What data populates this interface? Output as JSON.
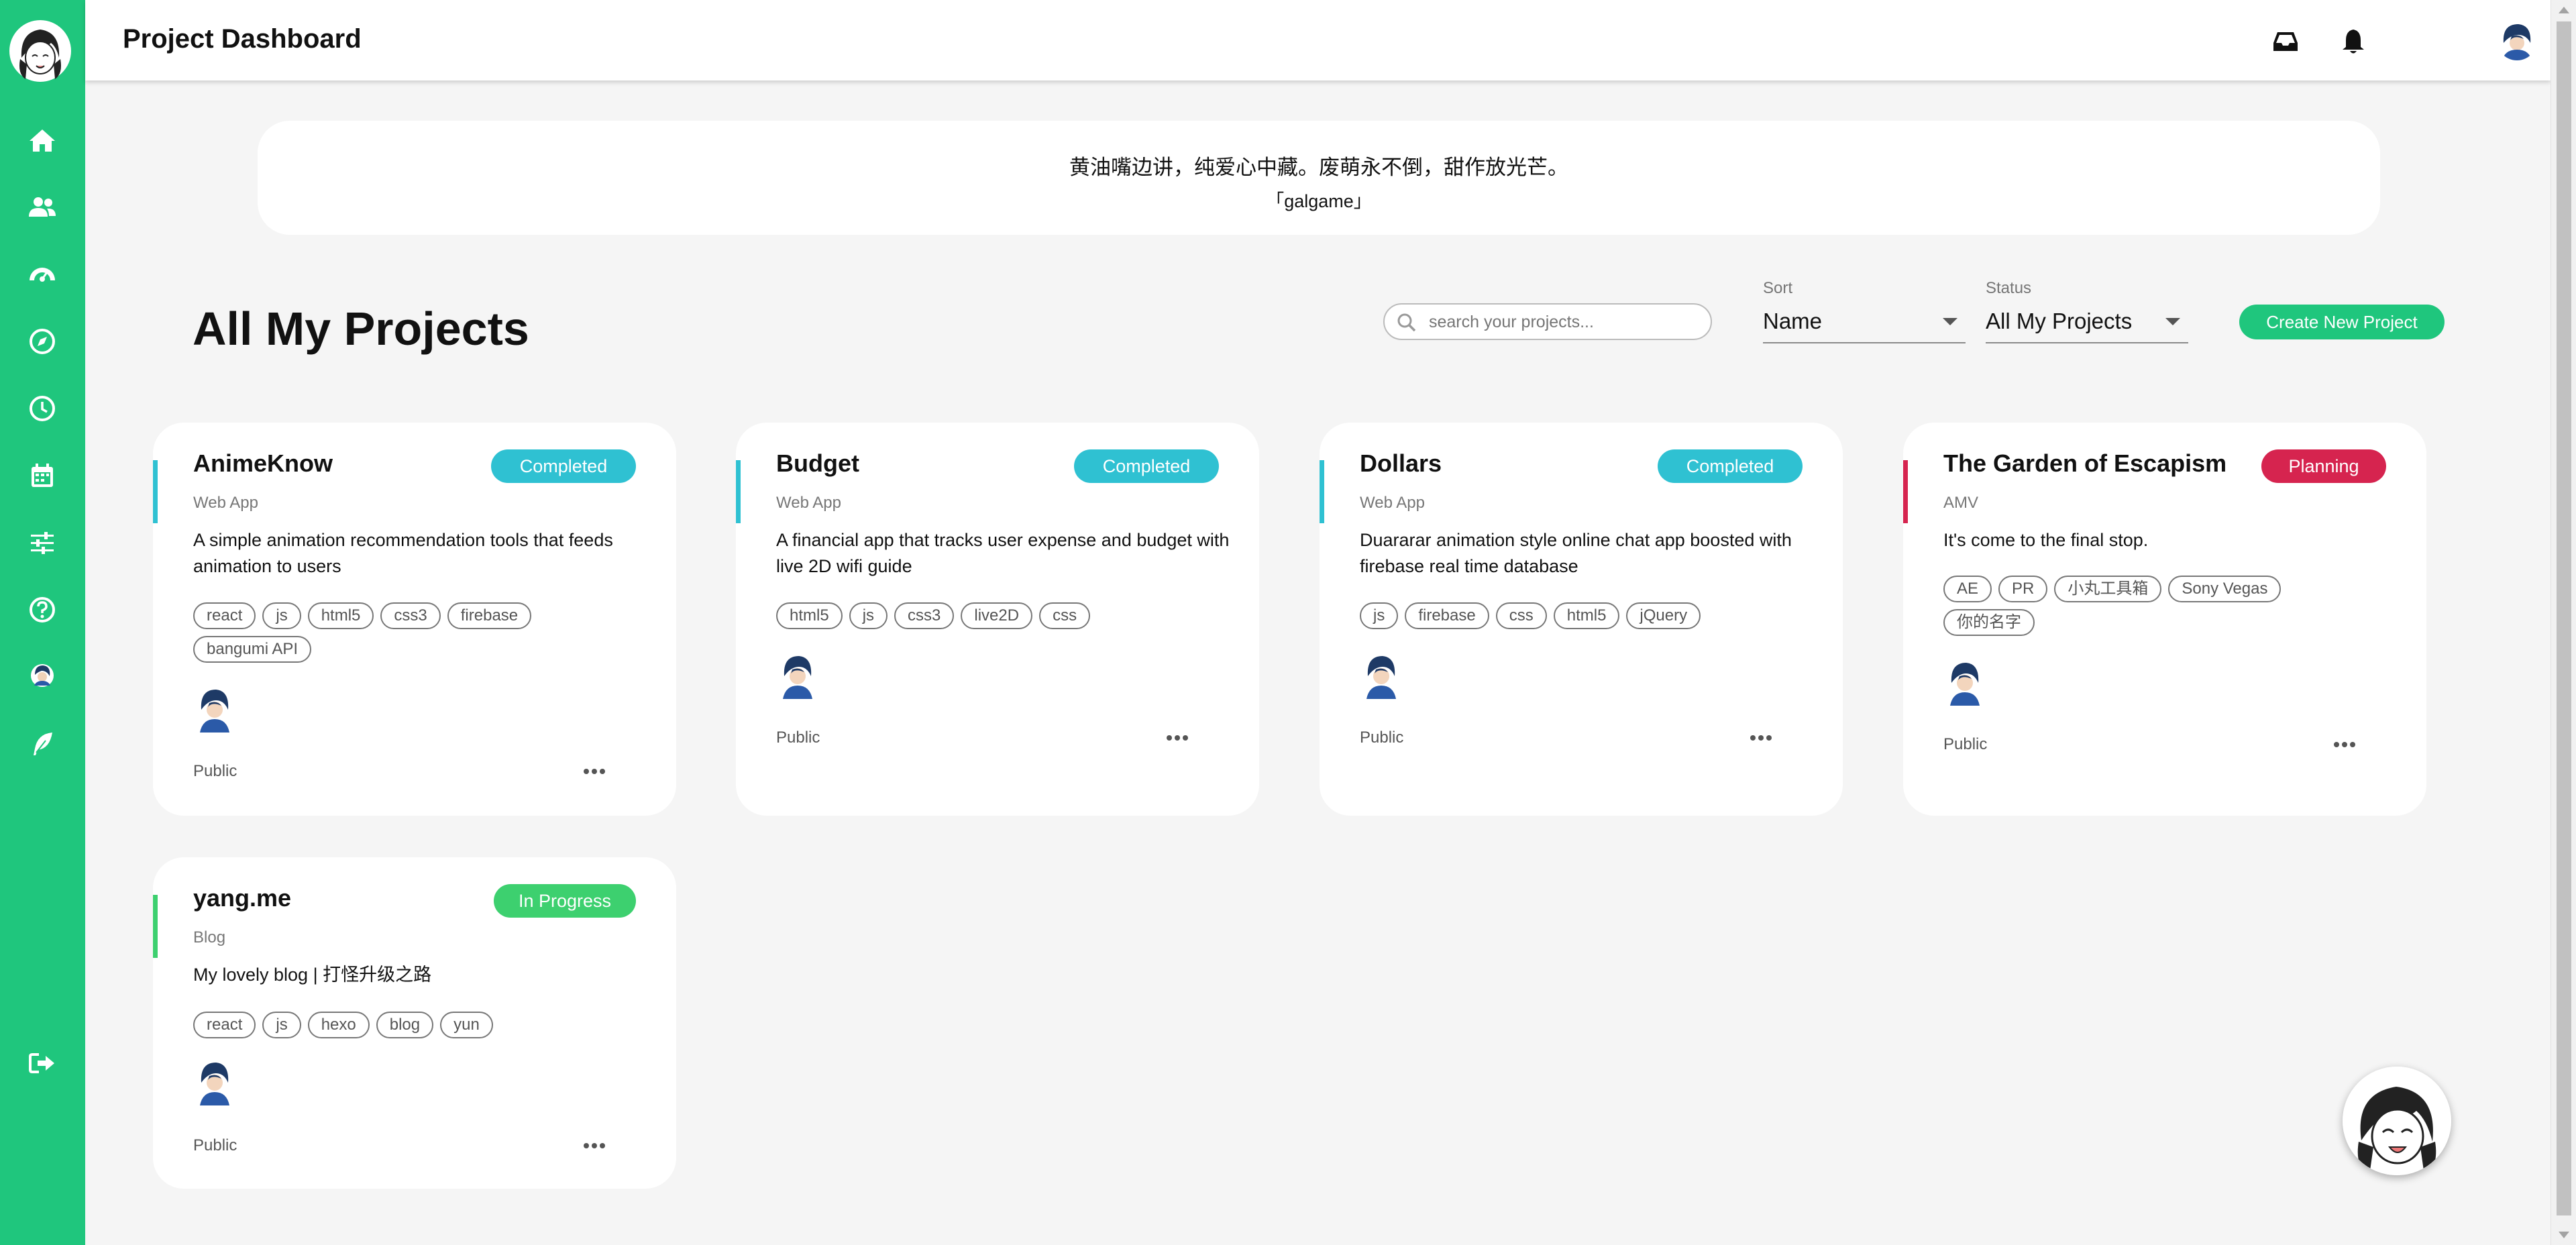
{
  "colors": {
    "brand": "#1fc67d",
    "completed": "#2fc1d2",
    "planning": "#d6244f",
    "in_progress": "#3dd06f"
  },
  "sidebar": {
    "logo": "anime-girl-logo",
    "items": [
      {
        "icon": "home-icon"
      },
      {
        "icon": "users-icon"
      },
      {
        "icon": "dashboard-gauge-icon"
      },
      {
        "icon": "compass-icon"
      },
      {
        "icon": "clock-icon"
      },
      {
        "icon": "calendar-icon"
      },
      {
        "icon": "sliders-icon"
      },
      {
        "icon": "help-icon"
      },
      {
        "icon": "user-avatar-icon"
      },
      {
        "icon": "feather-icon"
      },
      {
        "icon": "sign-out-icon"
      }
    ]
  },
  "header": {
    "title": "Project Dashboard",
    "icons": [
      "inbox-icon",
      "bell-icon",
      "user-avatar"
    ]
  },
  "quote": {
    "text": "黄油嘴边讲，纯爱心中藏。废萌永不倒，甜作放光芒。",
    "source": "「galgame」"
  },
  "projects_section": {
    "title": "All My Projects",
    "search_placeholder": "search your projects...",
    "sort_label": "Sort",
    "sort_value": "Name",
    "status_label": "Status",
    "status_value": "All My Projects",
    "create_button": "Create New Project"
  },
  "projects": [
    {
      "title": "AnimeKnow",
      "status": "Completed",
      "type": "Web App",
      "description": "A simple animation recommendation tools that feeds animation to users",
      "tags": [
        "react",
        "js",
        "html5",
        "css3",
        "firebase",
        "bangumi API"
      ],
      "visibility": "Public"
    },
    {
      "title": "Budget",
      "status": "Completed",
      "type": "Web App",
      "description": "A financial app that tracks user expense and budget with live 2D wifi guide",
      "tags": [
        "html5",
        "js",
        "css3",
        "live2D",
        "css"
      ],
      "visibility": "Public"
    },
    {
      "title": "Dollars",
      "status": "Completed",
      "type": "Web App",
      "description": "Duararar animation style online chat app boosted with firebase real time database",
      "tags": [
        "js",
        "firebase",
        "css",
        "html5",
        "jQuery"
      ],
      "visibility": "Public"
    },
    {
      "title": "The Garden of Escapism",
      "status": "Planning",
      "type": "AMV",
      "description": "It's come to the final stop.",
      "tags": [
        "AE",
        "PR",
        "小丸工具箱",
        "Sony Vegas",
        "你的名字"
      ],
      "visibility": "Public"
    },
    {
      "title": "yang.me",
      "status": "In Progress",
      "type": "Blog",
      "description": "My lovely blog | 打怪升级之路",
      "tags": [
        "react",
        "js",
        "hexo",
        "blog",
        "yun"
      ],
      "visibility": "Public"
    }
  ]
}
